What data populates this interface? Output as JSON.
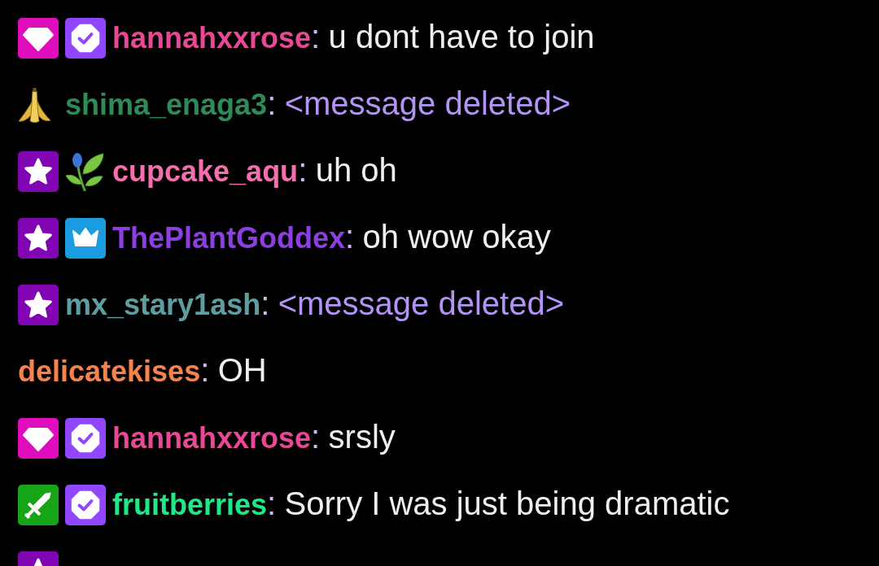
{
  "messages": [
    {
      "badges": [
        {
          "kind": "diamond"
        },
        {
          "kind": "verified"
        }
      ],
      "username": "hannahxxrose",
      "color": "#e84895",
      "separator": ":",
      "text": "u dont have to join",
      "deleted": false
    },
    {
      "badges": [
        {
          "kind": "banana"
        }
      ],
      "username": "shima_enaga3",
      "color": "#2e8b57",
      "separator": ":",
      "text": "<message deleted>",
      "deleted": true
    },
    {
      "badges": [
        {
          "kind": "star"
        },
        {
          "kind": "plant"
        }
      ],
      "username": "cupcake_aqu",
      "color": "#f56fae",
      "separator": ":",
      "text": "uh oh",
      "deleted": false
    },
    {
      "badges": [
        {
          "kind": "star"
        },
        {
          "kind": "crown"
        }
      ],
      "username": "ThePlantGoddex",
      "color": "#8c3fe0",
      "separator": ":",
      "text": "oh wow okay",
      "deleted": false
    },
    {
      "badges": [
        {
          "kind": "star"
        }
      ],
      "username": "mx_stary1ash",
      "color": "#5f9ea0",
      "separator": ":",
      "text": "<message deleted>",
      "deleted": true
    },
    {
      "username": "delicatekises",
      "color": "#f5824f",
      "separator": ":",
      "text": "OH",
      "deleted": false
    },
    {
      "badges": [
        {
          "kind": "diamond"
        },
        {
          "kind": "verified"
        }
      ],
      "username": "hannahxxrose",
      "color": "#e84895",
      "separator": ":",
      "text": "srsly",
      "deleted": false
    },
    {
      "badges": [
        {
          "kind": "sword"
        },
        {
          "kind": "verified"
        }
      ],
      "username": "fruitberries",
      "color": "#1ee887",
      "separator": ":",
      "text": "Sorry I was just being dramatic",
      "deleted": false
    },
    {
      "badges": [
        {
          "kind": "star"
        }
      ]
    }
  ]
}
